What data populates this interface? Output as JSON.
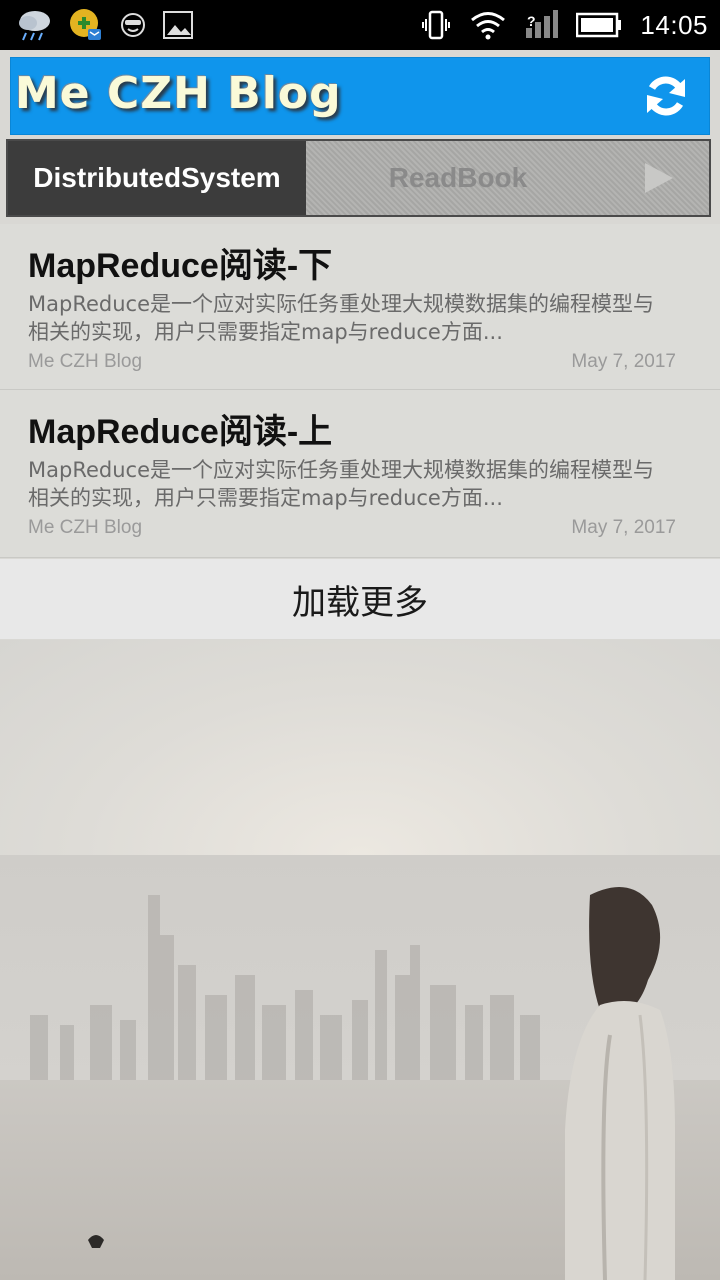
{
  "status_bar": {
    "time": "14:05",
    "left_icons": [
      "weather-rain-icon",
      "app-notification-icon",
      "face-icon",
      "image-icon"
    ],
    "right_icons": [
      "vibrate-icon",
      "wifi-icon",
      "signal-icon",
      "battery-icon"
    ]
  },
  "header": {
    "title": "Me CZH Blog",
    "refresh_icon": "refresh-icon",
    "background_color": "#0f95ec"
  },
  "tabs": [
    {
      "label": "DistributedSystem",
      "active": true
    },
    {
      "label": "ReadBook",
      "active": false
    }
  ],
  "posts": [
    {
      "title": "MapReduce阅读-下",
      "excerpt": "MapReduce是一个应对实际任务重处理大规模数据集的编程模型与相关的实现，用户只需要指定map与reduce方面...",
      "author": "Me CZH Blog",
      "date": "May 7, 2017"
    },
    {
      "title": "MapReduce阅读-上",
      "excerpt": "MapReduce是一个应对实际任务重处理大规模数据集的编程模型与相关的实现，用户只需要指定map与reduce方面...",
      "author": "Me CZH Blog",
      "date": "May 7, 2017"
    }
  ],
  "load_more": {
    "label": "加载更多"
  }
}
